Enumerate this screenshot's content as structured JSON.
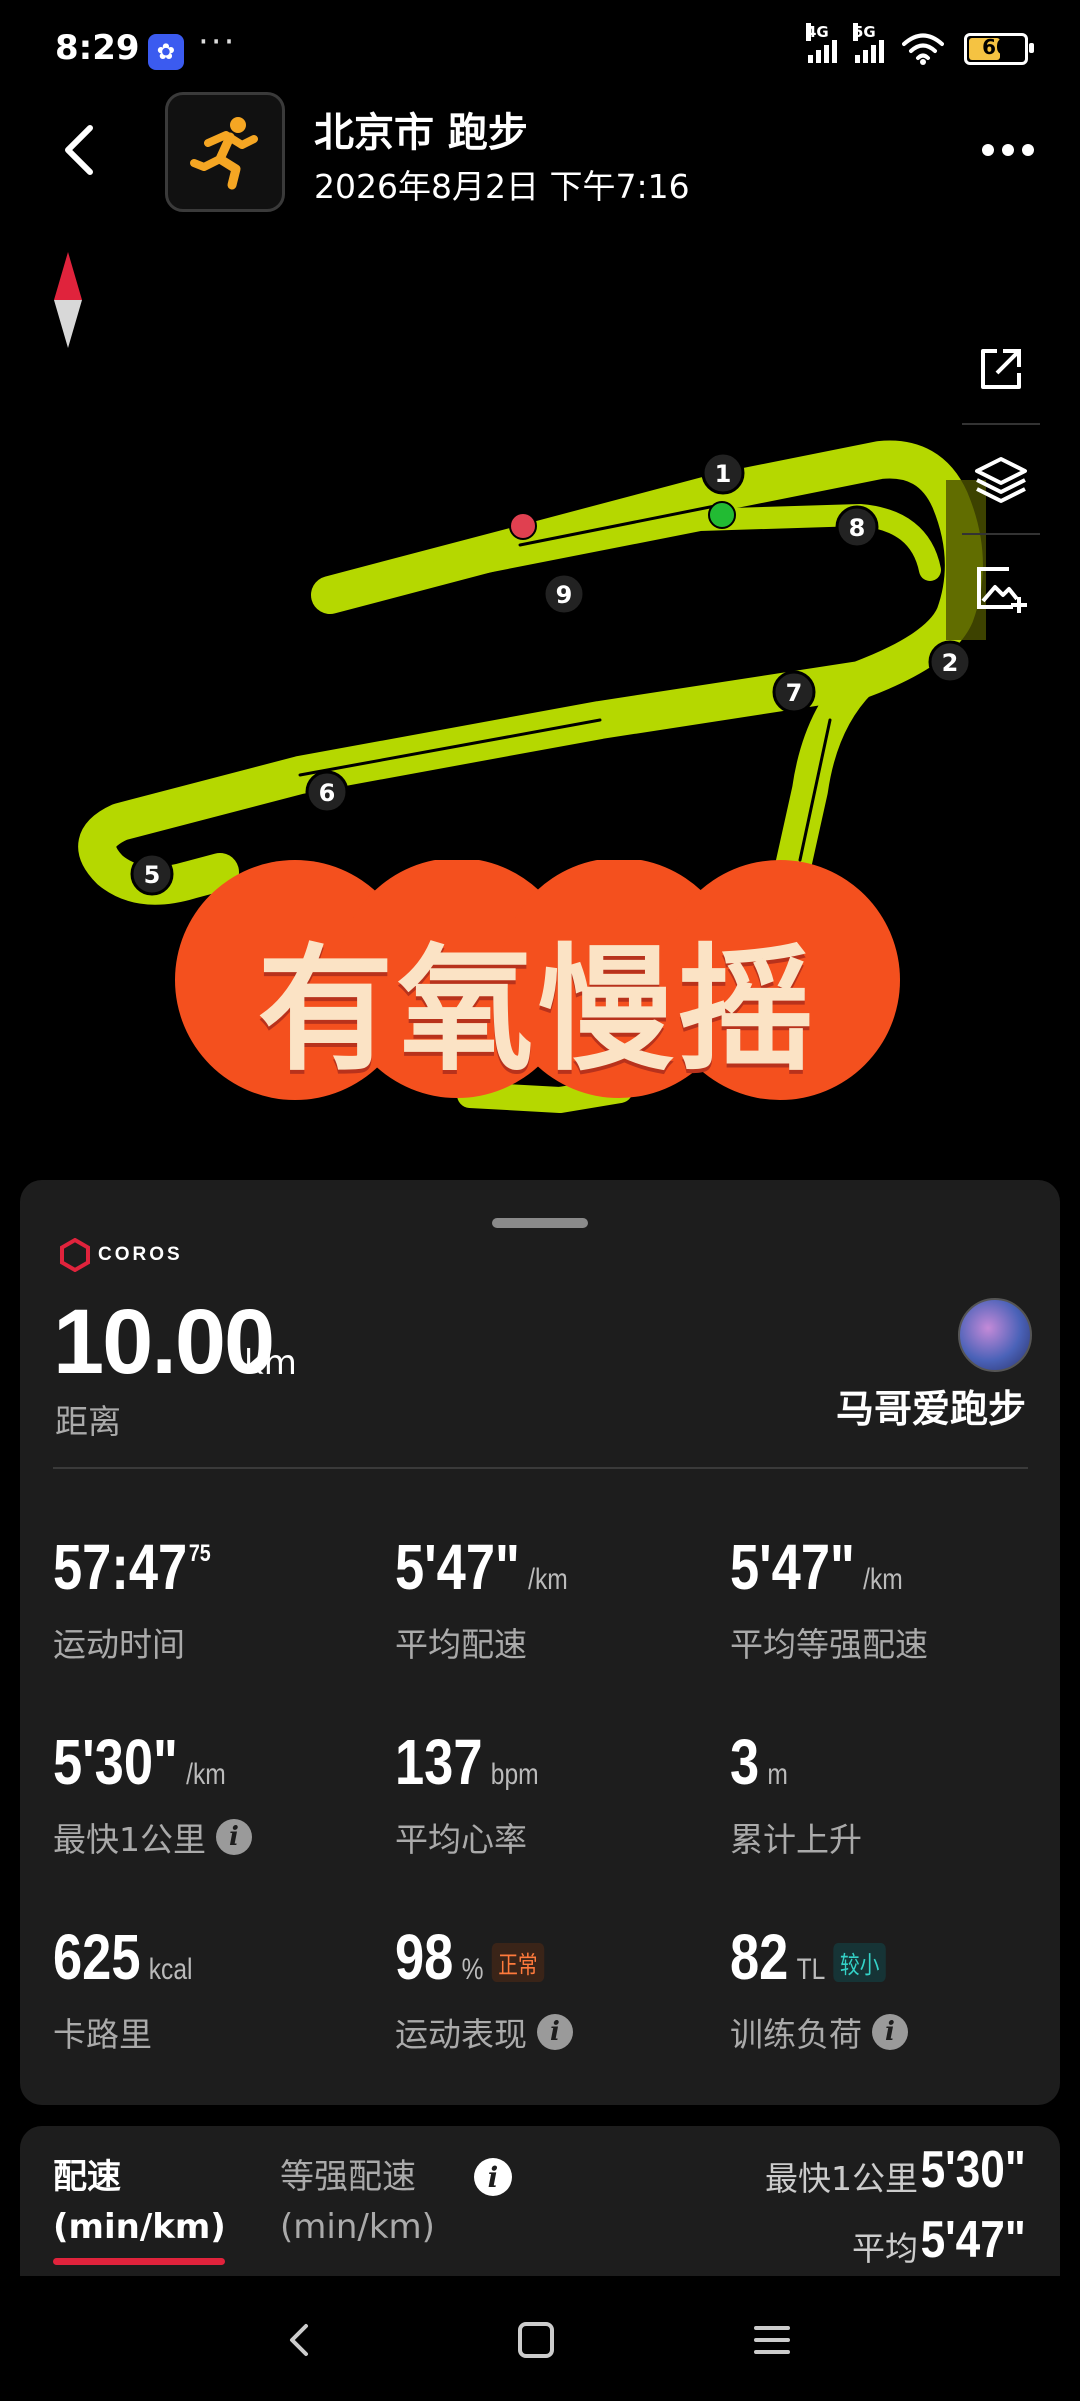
{
  "status_bar": {
    "time": "8:29",
    "app_badge": "✿",
    "more": "···",
    "net_1": "4G",
    "net_2": "5G",
    "battery_level": 60,
    "battery_text": "60"
  },
  "header": {
    "title": "北京市 跑步",
    "datetime": "2026年8月2日 下午7:16",
    "accent_color": "#f5a623"
  },
  "map": {
    "route_color": "#b5d800",
    "start_color": "#22bb33",
    "end_color": "#e04050",
    "km_markers": [
      "1",
      "2",
      "5",
      "6",
      "7",
      "8",
      "9"
    ]
  },
  "banner": {
    "text": "有氧慢摇",
    "color": "#f4501e"
  },
  "stats": {
    "brand": "COROS",
    "distance_value": "10.00",
    "distance_unit": "km",
    "distance_label": "距离",
    "username": "马哥爱跑步",
    "metrics": [
      {
        "value": "57:47",
        "sup": "75",
        "unit": "",
        "label": "运动时间",
        "info": false,
        "badge": ""
      },
      {
        "value": "5'47\"",
        "sup": "",
        "unit": "/km",
        "label": "平均配速",
        "info": false,
        "badge": ""
      },
      {
        "value": "5'47\"",
        "sup": "",
        "unit": "/km",
        "label": "平均等强配速",
        "info": false,
        "badge": ""
      },
      {
        "value": "5'30\"",
        "sup": "",
        "unit": "/km",
        "label": "最快1公里",
        "info": true,
        "badge": ""
      },
      {
        "value": "137",
        "sup": "",
        "unit": "bpm",
        "label": "平均心率",
        "info": false,
        "badge": ""
      },
      {
        "value": "3",
        "sup": "",
        "unit": "m",
        "label": "累计上升",
        "info": false,
        "badge": ""
      },
      {
        "value": "625",
        "sup": "",
        "unit": "kcal",
        "label": "卡路里",
        "info": false,
        "badge": ""
      },
      {
        "value": "98",
        "sup": "",
        "unit": "%",
        "label": "运动表现",
        "info": true,
        "badge": "正常"
      },
      {
        "value": "82",
        "sup": "",
        "unit": "TL",
        "label": "训练负荷",
        "info": true,
        "badge": "较小"
      }
    ]
  },
  "pace": {
    "tab_pace": "配速",
    "tab_pace_unit": "(min/km)",
    "tab_equal": "等强配速",
    "tab_equal_unit": "(min/km)",
    "fastest_label": "最快1公里",
    "fastest_value": "5'30\"",
    "avg_label": "平均",
    "avg_value": "5'47\""
  }
}
